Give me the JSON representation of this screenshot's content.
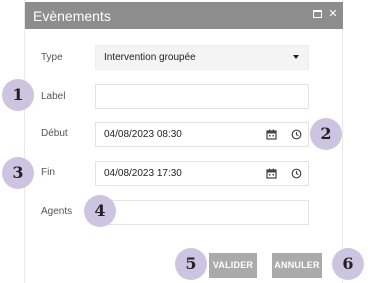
{
  "dialog": {
    "title": "Evènements",
    "maximize_icon": "maximize-icon",
    "close_icon": "close-icon",
    "close_glyph": "✕"
  },
  "form": {
    "type_label": "Type",
    "type_value": "Intervention groupée",
    "label_label": "Label",
    "label_value": "",
    "debut_label": "Début",
    "debut_value": "04/08/2023 08:30",
    "fin_label": "Fin",
    "fin_value": "04/08/2023 17:30",
    "agents_label": "Agents",
    "agents_value": "",
    "calendar_icon": "calendar-icon",
    "clock_icon": "clock-icon",
    "dropdown_icon": "chevron-down-icon"
  },
  "buttons": {
    "valider": "VALIDER",
    "annuler": "ANNULER"
  },
  "badges": [
    "1",
    "2",
    "3",
    "4",
    "5",
    "6"
  ],
  "colors": {
    "titlebar": "#8d8d8d",
    "button": "#aaaaaa",
    "badge": "#cdc4e2"
  }
}
